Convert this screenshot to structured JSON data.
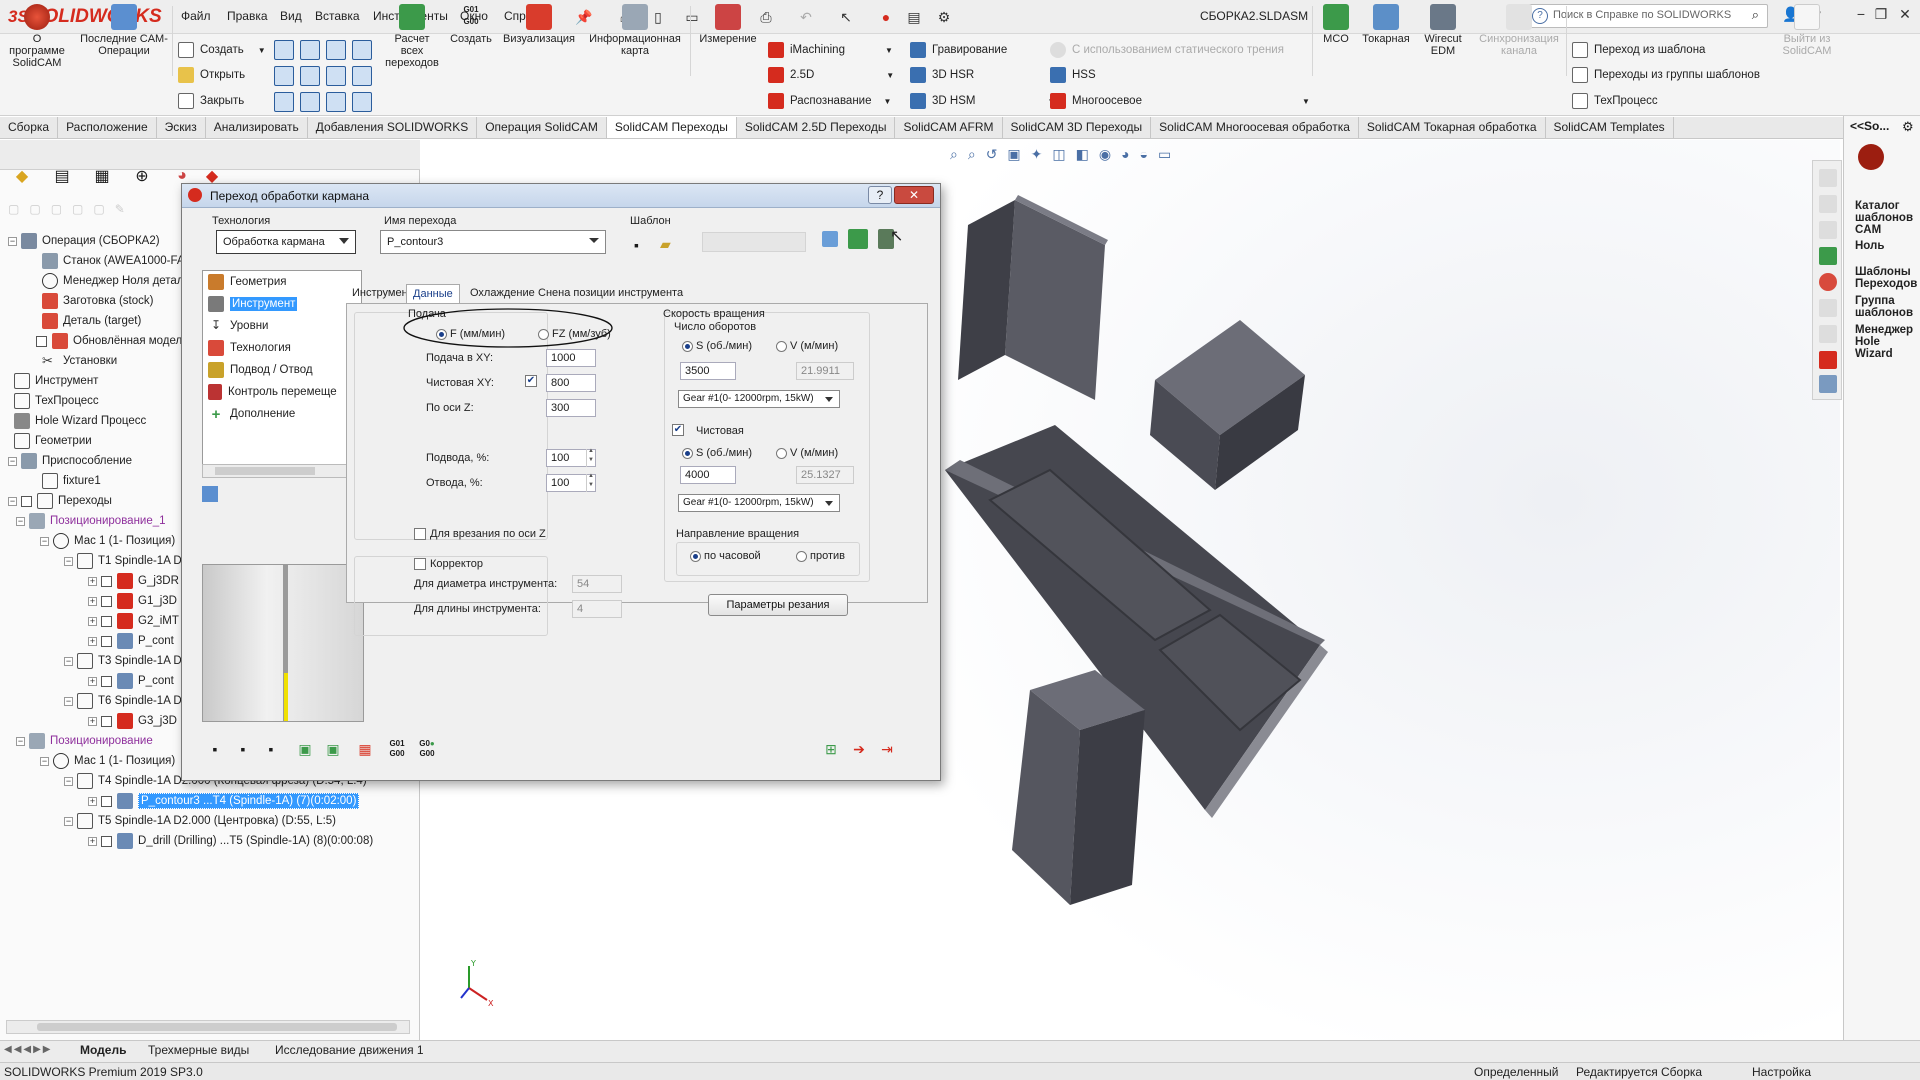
{
  "app": {
    "logo_text": "SOLIDWORKS",
    "menu": [
      "Файл",
      "Правка",
      "Вид",
      "Вставка",
      "Инструменты",
      "Окно",
      "Справка"
    ],
    "document_title": "СБОРКА2.SLDASM",
    "help_search_placeholder": "Поиск в Справке по SOLIDWORKS"
  },
  "ribbon": {
    "about": "О программе SolidCAM",
    "recent": "Последние CAM-Операции",
    "create": "Создать",
    "open": "Открыть",
    "close": "Закрыть",
    "calc": "Расчет всех переходов",
    "gcode_create": "Создать",
    "visualization": "Визуализация",
    "infocard": "Информационная карта",
    "measure": "Измерение",
    "imachining": "iMachining",
    "d25": "2.5D",
    "recognition": "Распознавание",
    "engraving": "Гравирование",
    "hsr": "3D HSR",
    "hsm": "3D HSM",
    "static_friction": "С использованием статического трения",
    "hss": "HSS",
    "multiaxis": "Многоосевое",
    "mco": "MCO",
    "turning": "Токарная",
    "wirecut": "Wirecut EDM",
    "sync": "Синхронизация канала",
    "from_template": "Переход из шаблона",
    "from_template_group": "Переходы из группы шаблонов",
    "techprocess": "ТехПроцесс",
    "exit": "Выйти из SolidCAM"
  },
  "tabs": [
    "Сборка",
    "Расположение",
    "Эскиз",
    "Анализировать",
    "Добавления SOLIDWORKS",
    "Операция SolidCAM",
    "SolidCAM Переходы",
    "SolidCAM 2.5D Переходы",
    "SolidCAM AFRM",
    "SolidCAM 3D Переходы",
    "SolidCAM Многоосевая обработка",
    "SolidCAM Токарная обработка",
    "SolidCAM Templates"
  ],
  "tree": {
    "items": [
      "Операция (СБОРКА2)",
      "Станок (AWEA1000-FAN",
      "Менеджер Ноля детали",
      "Заготовка (stock)",
      "Деталь (target)",
      "Обновлённая модель",
      "Установки",
      "Инструмент",
      "ТехПроцесс",
      "Hole Wizard Процесс",
      "Геометрии",
      "Приспособление",
      "fixture1",
      "Переходы",
      "Позиционирование_1",
      "Мас 1 (1- Позиция)",
      "T1 Spindle-1A D",
      "G_j3DR",
      "G1_j3D",
      "G2_iMT",
      "P_cont",
      "T3 Spindle-1A D",
      "P_cont",
      "T6 Spindle-1A D",
      "G3_j3D",
      "Позиционирование",
      "Мас 1 (1- Позиция)",
      "T4 Spindle-1A D2.000  (Концевая фреза) (D:54, L:4)",
      "P_contour3 ...T4 (Spindle-1A) (7)(0:02:00)",
      "T5 Spindle-1A D2.000  (Центровка) (D:55, L:5)",
      "D_drill (Drilling) ...T5 (Spindle-1A) (8)(0:00:08)"
    ]
  },
  "bottom_tabs": [
    "Модель",
    "Трехмерные виды",
    "Исследование движения 1"
  ],
  "status": {
    "left": "SOLIDWORKS Premium 2019 SP3.0",
    "defined": "Определенный",
    "editing": "Редактируется Сборка",
    "settings": "Настройка"
  },
  "right_pane": {
    "header": "<<So...",
    "items": [
      "Каталог шаблонов CAM",
      "Ноль",
      "Шаблоны Переходов",
      "Группа шаблонов",
      "Менеджер Hole Wizard"
    ]
  },
  "dialog": {
    "title": "Переход обработки кармана",
    "technology_label": "Технология",
    "technology_value": "Обработка кармана",
    "op_name_label": "Имя перехода",
    "op_name_value": "P_contour3",
    "template_label": "Шаблон",
    "nav": [
      "Геометрия",
      "Инструмент",
      "Уровни",
      "Технология",
      "Подвод / Отвод",
      "Контроль перемеще",
      "Дополнение"
    ],
    "tabs": [
      "Инструмент",
      "Данные",
      "Охлаждение",
      "Снена позиции инструмента"
    ],
    "feed": {
      "group": "Подача",
      "f_mode": "F (мм/мин)",
      "fz_mode": "FZ (мм/зуб)",
      "xy_label": "Подача в XY:",
      "xy_value": "1000",
      "finish_label": "Чистовая XY:",
      "finish_value": "800",
      "z_label": "По оси Z:",
      "z_value": "300",
      "lead_in_label": "Подвода, %:",
      "lead_in_value": "100",
      "lead_out_label": "Отвода, %:",
      "lead_out_value": "100",
      "plunge_label": "Для врезания по оси Z"
    },
    "compensation": {
      "label": "Корректор",
      "diameter_label": "Для диаметра инструмента:",
      "diameter_value": "54",
      "length_label": "Для длины инструмента:",
      "length_value": "4"
    },
    "spin": {
      "group": "Скорость вращения",
      "rpm_label": "Число оборотов",
      "s_label": "S (об./мин)",
      "v_label": "V (м/мин)",
      "s_value": "3500",
      "v_value": "21.9911",
      "gear": "Gear #1(0- 12000rpm, 15kW)",
      "finish_label": "Чистовая",
      "finish_s_value": "4000",
      "finish_v_value": "25.1327",
      "finish_gear": "Gear #1(0- 12000rpm, 15kW)",
      "direction_label": "Направление вращения",
      "cw": "по часовой",
      "ccw": "против",
      "cut_params_button": "Параметры резания"
    },
    "g01": "G01",
    "g00": "G00",
    "g0_text": "G0"
  },
  "colors": {
    "accent_red": "#d52b1e",
    "selection_blue": "#3399ff",
    "purple_text": "#8e2f9c",
    "model_gray": "#4b4c55"
  }
}
